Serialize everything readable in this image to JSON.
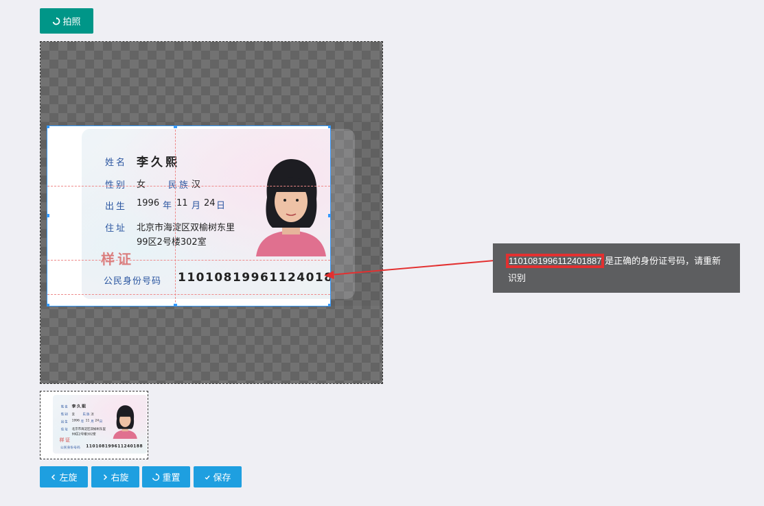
{
  "toolbar": {
    "capture_label": "拍照",
    "capture_icon": "refresh-icon"
  },
  "card": {
    "name_label": "姓名",
    "name_value": "李久熙",
    "sex_label": "性别",
    "sex_value": "女",
    "ethnic_label": "民族",
    "ethnic_value": "汉",
    "birth_label": "出生",
    "birth_year": "1996",
    "birth_year_unit": "年",
    "birth_month": "11",
    "birth_month_unit": "月",
    "birth_day": "24",
    "birth_day_unit": "日",
    "address_label": "住址",
    "address_line1": "北京市海淀区双榆树东里",
    "address_line2": "99区2号楼302室",
    "sample_mark": "样证",
    "id_label": "公民身份号码",
    "id_number": "110108199611240188"
  },
  "tooltip": {
    "highlight": "11010819961124018​87",
    "message": "是正确的身份证号码，请重新识别"
  },
  "actions": {
    "rotate_left": "左旋",
    "rotate_right": "右旋",
    "reset": "重置",
    "save": "保存"
  },
  "colors": {
    "primary": "#009688",
    "action": "#1e9fe0",
    "tooltip_bg": "#5d5e60",
    "highlight": "#e33030",
    "crop_border": "#3399ff"
  }
}
